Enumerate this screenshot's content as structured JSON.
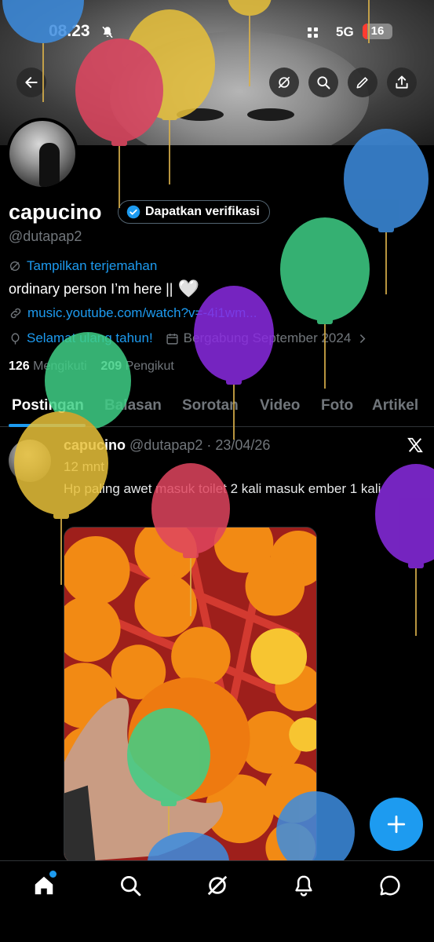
{
  "status_bar": {
    "time": "08.23",
    "network": "5G",
    "battery_level": "16",
    "battery_fraction": 0.16
  },
  "header": {
    "buttons": [
      "back-arrow-icon",
      "grok-icon",
      "search-icon",
      "edit-icon",
      "share-icon"
    ]
  },
  "profile": {
    "display_name": "capucino",
    "verify_label": "Dapatkan verifikasi",
    "handle": "@dutapap2",
    "translate_label": "Tampilkan terjemahan",
    "bio": "ordinary person I’m here ||",
    "link": "music.youtube.com/watch?v=-4i1wm...",
    "birthday": "Selamat ulang tahun!",
    "joined": "Bergabung September 2024",
    "following_count": "126",
    "following_label": "Mengikuti",
    "followers_count": "209",
    "followers_label": "Pengikut"
  },
  "tabs": [
    {
      "label": "Postingan",
      "active": true
    },
    {
      "label": "Balasan",
      "active": false
    },
    {
      "label": "Sorotan",
      "active": false
    },
    {
      "label": "Video",
      "active": false
    },
    {
      "label": "Foto",
      "active": false
    },
    {
      "label": "Artikel",
      "active": false
    }
  ],
  "post": {
    "author": "capucino",
    "meta": "@dutapap2 · 23/04/26",
    "duration": "12 mnt",
    "text": "Hp paling awet masuk toilet 2 kali masuk ember 1 kali"
  },
  "bottom_nav": [
    "home-icon",
    "search-icon",
    "grok-icon",
    "notifications-icon",
    "messages-icon"
  ],
  "colors": {
    "accent": "#1d9bf0",
    "background": "#000000",
    "muted": "#71767b"
  }
}
